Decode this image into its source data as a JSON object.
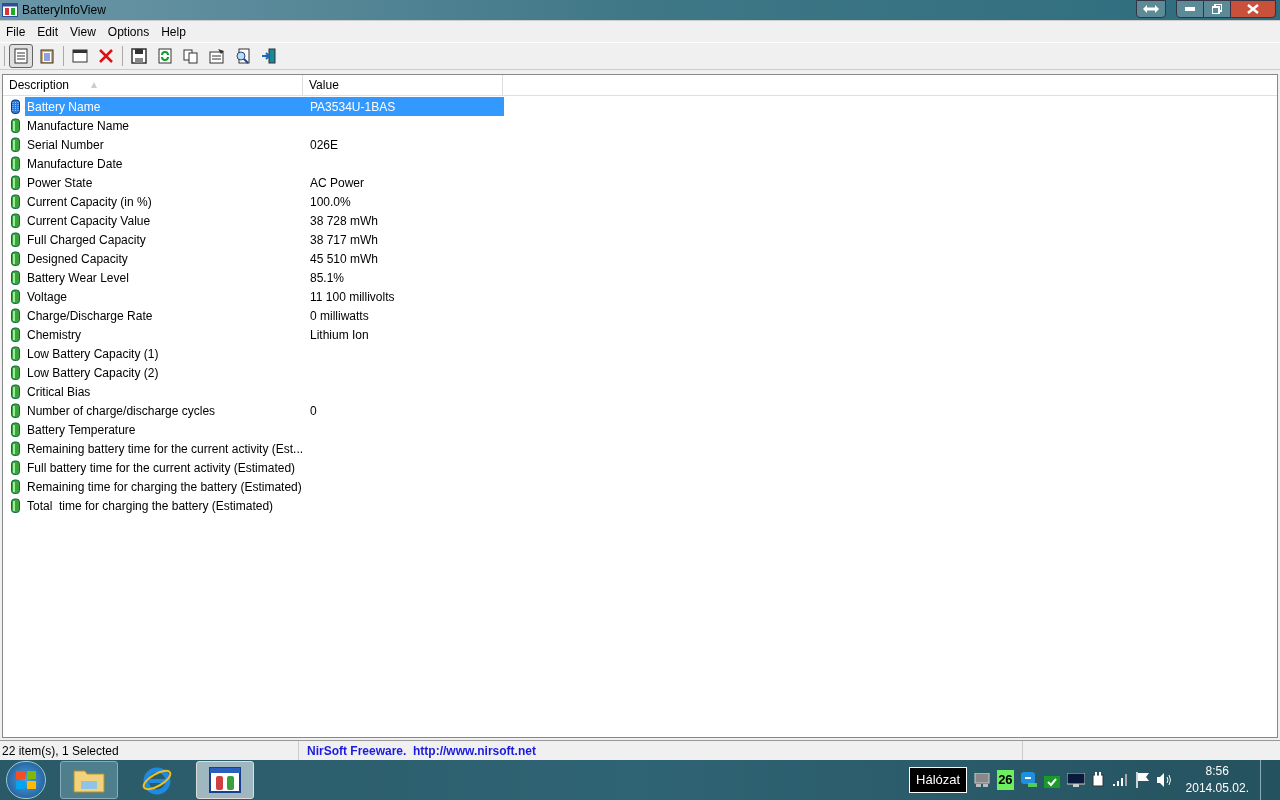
{
  "window": {
    "title": "BatteryInfoView"
  },
  "menu": [
    "File",
    "Edit",
    "View",
    "Options",
    "Help"
  ],
  "toolbar_buttons": [
    {
      "kind": "list",
      "pressed": true
    },
    {
      "kind": "clipboard",
      "pressed": false
    },
    {
      "kind": "window",
      "pressed": false
    },
    {
      "kind": "delete",
      "pressed": false
    },
    {
      "kind": "save",
      "pressed": false
    },
    {
      "kind": "refresh",
      "pressed": false
    },
    {
      "kind": "copy",
      "pressed": false
    },
    {
      "kind": "properties",
      "pressed": false
    },
    {
      "kind": "find",
      "pressed": false
    },
    {
      "kind": "exit",
      "pressed": false
    }
  ],
  "table": {
    "columns": [
      "Description",
      "Value"
    ],
    "rows": [
      {
        "description": "Battery Name",
        "value": "PA3534U-1BAS",
        "selected": true
      },
      {
        "description": "Manufacture Name",
        "value": "",
        "selected": false
      },
      {
        "description": "Serial Number",
        "value": "026E",
        "selected": false
      },
      {
        "description": "Manufacture Date",
        "value": "",
        "selected": false
      },
      {
        "description": "Power State",
        "value": "AC Power",
        "selected": false
      },
      {
        "description": "Current Capacity (in %)",
        "value": "100.0%",
        "selected": false
      },
      {
        "description": "Current Capacity Value",
        "value": "38 728 mWh",
        "selected": false
      },
      {
        "description": "Full Charged Capacity",
        "value": "38 717 mWh",
        "selected": false
      },
      {
        "description": "Designed Capacity",
        "value": "45 510 mWh",
        "selected": false
      },
      {
        "description": "Battery Wear Level",
        "value": "85.1%",
        "selected": false
      },
      {
        "description": "Voltage",
        "value": "11 100 millivolts",
        "selected": false
      },
      {
        "description": "Charge/Discharge Rate",
        "value": "0 milliwatts",
        "selected": false
      },
      {
        "description": "Chemistry",
        "value": "Lithium Ion",
        "selected": false
      },
      {
        "description": "Low Battery Capacity (1)",
        "value": "",
        "selected": false
      },
      {
        "description": "Low Battery Capacity (2)",
        "value": "",
        "selected": false
      },
      {
        "description": "Critical Bias",
        "value": "",
        "selected": false
      },
      {
        "description": "Number of charge/discharge cycles",
        "value": "0",
        "selected": false
      },
      {
        "description": "Battery Temperature",
        "value": "",
        "selected": false
      },
      {
        "description": "Remaining battery time for the current activity (Est...",
        "value": "",
        "selected": false
      },
      {
        "description": "Full battery time for the current activity (Estimated)",
        "value": "",
        "selected": false
      },
      {
        "description": "Remaining time for charging the battery (Estimated)",
        "value": "",
        "selected": false
      },
      {
        "description": "Total  time for charging the battery (Estimated)",
        "value": "",
        "selected": false
      }
    ]
  },
  "status_bar": {
    "count": "22 item(s), 1 Selected",
    "credit": "NirSoft Freeware.  http://www.nirsoft.net"
  },
  "taskbar": {
    "buttons": [
      {
        "kind": "folder",
        "active": false
      },
      {
        "kind": "browser",
        "active": false
      },
      {
        "kind": "app",
        "active": true
      }
    ],
    "tooltip": "Hálózat",
    "tray_badge": "26",
    "time": "8:56",
    "date": "2014.05.02."
  }
}
